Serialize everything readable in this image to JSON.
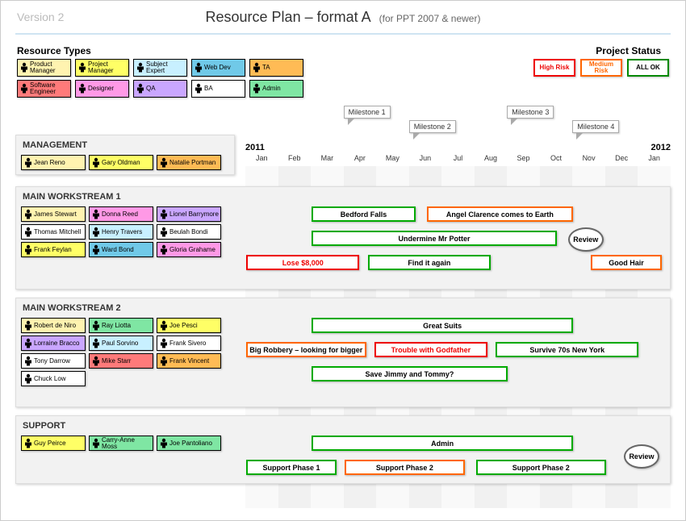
{
  "version": "Version 2",
  "title": "Resource Plan – format A",
  "subtitle": "(for PPT 2007 & newer)",
  "resource_types_title": "Resource Types",
  "resource_types": [
    {
      "label": "Product Manager",
      "color": "#fff3b0"
    },
    {
      "label": "Project Manager",
      "color": "#ffff66"
    },
    {
      "label": "Subject Expert",
      "color": "#c8f0ff"
    },
    {
      "label": "Web Dev",
      "color": "#70c9e8"
    },
    {
      "label": "TA",
      "color": "#ffbb55"
    },
    {
      "label": "Software Engineer",
      "color": "#ff7a7a"
    },
    {
      "label": "Designer",
      "color": "#ff99e6"
    },
    {
      "label": "QA",
      "color": "#c9a6ff"
    },
    {
      "label": "BA",
      "color": "#ffffff"
    },
    {
      "label": "Admin",
      "color": "#7fe6a3"
    }
  ],
  "project_status_title": "Project Status",
  "project_status": {
    "high": "High Risk",
    "medium": "Medium Risk",
    "ok": "ALL OK"
  },
  "timeline": {
    "year_start": "2011",
    "year_end": "2012",
    "months": [
      "Jan",
      "Feb",
      "Mar",
      "Apr",
      "May",
      "Jun",
      "Jul",
      "Aug",
      "Sep",
      "Oct",
      "Nov",
      "Dec",
      "Jan"
    ],
    "milestones": [
      {
        "label": "Milestone 1",
        "col": 3
      },
      {
        "label": "Milestone 2",
        "col": 5
      },
      {
        "label": "Milestone 3",
        "col": 8
      },
      {
        "label": "Milestone 4",
        "col": 10
      }
    ]
  },
  "sections": {
    "management": {
      "title": "MANAGEMENT",
      "people": [
        {
          "label": "Jean Reno",
          "color": "#fff3b0"
        },
        {
          "label": "Gary Oldman",
          "color": "#ffff66"
        },
        {
          "label": "Natalie Portman",
          "color": "#ffbb55"
        }
      ]
    },
    "ws1": {
      "title": "MAIN WORKSTREAM  1",
      "people": [
        {
          "label": "James Stewart",
          "color": "#fff3b0"
        },
        {
          "label": "Donna Reed",
          "color": "#ff99e6"
        },
        {
          "label": "Lionel Barrymore",
          "color": "#c9a6ff"
        },
        {
          "label": "Thomas Mitchell",
          "color": "#ffffff"
        },
        {
          "label": "Henry Travers",
          "color": "#c8f0ff"
        },
        {
          "label": "Beulah Bondi",
          "color": "#ffffff"
        },
        {
          "label": "Frank Feylan",
          "color": "#ffff66"
        },
        {
          "label": "Ward Bond",
          "color": "#70c9e8"
        },
        {
          "label": "Gloria Grahame",
          "color": "#ff99e6"
        }
      ],
      "bars": [
        {
          "label": "Bedford Falls",
          "row": 0,
          "start": 2.0,
          "end": 5.2,
          "status": "green"
        },
        {
          "label": "Angel Clarence comes to Earth",
          "row": 0,
          "start": 5.5,
          "end": 10.0,
          "status": "orange"
        },
        {
          "label": "Undermine Mr Potter",
          "row": 1,
          "start": 2.0,
          "end": 9.5,
          "status": "green"
        },
        {
          "label": "Lose $8,000",
          "row": 2,
          "start": 0.0,
          "end": 3.5,
          "status": "red",
          "redtext": true
        },
        {
          "label": "Find it again",
          "row": 2,
          "start": 3.7,
          "end": 7.5,
          "status": "green"
        },
        {
          "label": "Good Hair",
          "row": 2,
          "start": 10.5,
          "end": 12.7,
          "status": "orange"
        }
      ],
      "review": {
        "label": "Review",
        "row": 1,
        "col": 9.8
      }
    },
    "ws2": {
      "title": "MAIN WORKSTREAM  2",
      "people": [
        {
          "label": "Robert de Niro",
          "color": "#fff3b0"
        },
        {
          "label": "Ray Liotta",
          "color": "#7fe6a3"
        },
        {
          "label": "Joe Pesci",
          "color": "#ffff66"
        },
        {
          "label": "Lorraine Bracco",
          "color": "#c9a6ff"
        },
        {
          "label": "Paul Sorvino",
          "color": "#c8f0ff"
        },
        {
          "label": "Frank Sivero",
          "color": "#ffffff"
        },
        {
          "label": "Tony Darrow",
          "color": "#ffffff"
        },
        {
          "label": "Mike Starr",
          "color": "#ff7a7a"
        },
        {
          "label": "Frank Vincent",
          "color": "#ffbb55"
        },
        {
          "label": "Chuck Low",
          "color": "#ffffff"
        }
      ],
      "bars": [
        {
          "label": "Great Suits",
          "row": 0,
          "start": 2.0,
          "end": 10.0,
          "status": "green"
        },
        {
          "label": "Big Robbery – looking for bigger",
          "row": 1,
          "start": 0.0,
          "end": 3.7,
          "status": "orange"
        },
        {
          "label": "Trouble with Godfather",
          "row": 1,
          "start": 3.9,
          "end": 7.4,
          "status": "red",
          "redtext": true
        },
        {
          "label": "Survive 70s New York",
          "row": 1,
          "start": 7.6,
          "end": 12.0,
          "status": "green"
        },
        {
          "label": "Save Jimmy and Tommy?",
          "row": 2,
          "start": 2.0,
          "end": 8.0,
          "status": "green"
        }
      ]
    },
    "support": {
      "title": "SUPPORT",
      "people": [
        {
          "label": "Guy Peirce",
          "color": "#ffff66"
        },
        {
          "label": "Carry-Anne Moss",
          "color": "#7fe6a3"
        },
        {
          "label": "Joe Pantoliano",
          "color": "#7fe6a3"
        }
      ],
      "bars": [
        {
          "label": "Admin",
          "row": 0,
          "start": 2.0,
          "end": 10.0,
          "status": "green"
        },
        {
          "label": "Support Phase 1",
          "row": 1,
          "start": 0.0,
          "end": 2.8,
          "status": "green"
        },
        {
          "label": "Support Phase 2",
          "row": 1,
          "start": 3.0,
          "end": 6.7,
          "status": "orange"
        },
        {
          "label": "Support Phase 2",
          "row": 1,
          "start": 7.0,
          "end": 11.0,
          "status": "green"
        }
      ],
      "review": {
        "label": "Review",
        "row": 0.5,
        "col": 11.5
      }
    }
  },
  "chart_data": {
    "type": "gantt",
    "x_unit": "month",
    "x_categories": [
      "2011-Jan",
      "Feb",
      "Mar",
      "Apr",
      "May",
      "Jun",
      "Jul",
      "Aug",
      "Sep",
      "Oct",
      "Nov",
      "Dec",
      "2012-Jan"
    ],
    "xlim": [
      0,
      13
    ],
    "legend": {
      "bar_status": {
        "green": "ALL OK",
        "orange": "Medium Risk",
        "red": "High Risk"
      }
    },
    "milestones": [
      {
        "name": "Milestone 1",
        "month_index": 3
      },
      {
        "name": "Milestone 2",
        "month_index": 5
      },
      {
        "name": "Milestone 3",
        "month_index": 8
      },
      {
        "name": "Milestone 4",
        "month_index": 10
      }
    ],
    "streams": [
      {
        "name": "MAIN WORKSTREAM 1",
        "tasks": [
          {
            "name": "Bedford Falls",
            "start": 2.0,
            "end": 5.2,
            "status": "green"
          },
          {
            "name": "Angel Clarence comes to Earth",
            "start": 5.5,
            "end": 10.0,
            "status": "orange"
          },
          {
            "name": "Undermine Mr Potter",
            "start": 2.0,
            "end": 9.5,
            "status": "green"
          },
          {
            "name": "Lose $8,000",
            "start": 0.0,
            "end": 3.5,
            "status": "red"
          },
          {
            "name": "Find it again",
            "start": 3.7,
            "end": 7.5,
            "status": "green"
          },
          {
            "name": "Good Hair",
            "start": 10.5,
            "end": 12.7,
            "status": "orange"
          }
        ],
        "review_at": 9.8
      },
      {
        "name": "MAIN WORKSTREAM 2",
        "tasks": [
          {
            "name": "Great Suits",
            "start": 2.0,
            "end": 10.0,
            "status": "green"
          },
          {
            "name": "Big Robbery – looking for bigger",
            "start": 0.0,
            "end": 3.7,
            "status": "orange"
          },
          {
            "name": "Trouble with Godfather",
            "start": 3.9,
            "end": 7.4,
            "status": "red"
          },
          {
            "name": "Survive 70s New York",
            "start": 7.6,
            "end": 12.0,
            "status": "green"
          },
          {
            "name": "Save Jimmy and Tommy?",
            "start": 2.0,
            "end": 8.0,
            "status": "green"
          }
        ]
      },
      {
        "name": "SUPPORT",
        "tasks": [
          {
            "name": "Admin",
            "start": 2.0,
            "end": 10.0,
            "status": "green"
          },
          {
            "name": "Support Phase 1",
            "start": 0.0,
            "end": 2.8,
            "status": "green"
          },
          {
            "name": "Support Phase 2",
            "start": 3.0,
            "end": 6.7,
            "status": "orange"
          },
          {
            "name": "Support Phase 2",
            "start": 7.0,
            "end": 11.0,
            "status": "green"
          }
        ],
        "review_at": 11.5
      }
    ]
  }
}
